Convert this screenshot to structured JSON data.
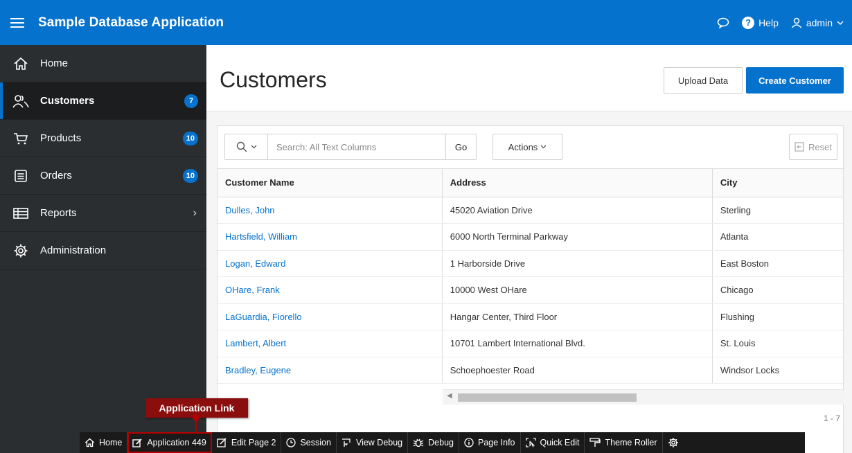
{
  "header": {
    "app_title": "Sample Database Application",
    "help_label": "Help",
    "user_label": "admin",
    "accent_color": "#0572ce"
  },
  "sidebar": {
    "items": [
      {
        "label": "Home",
        "icon": "home-icon"
      },
      {
        "label": "Customers",
        "icon": "users-icon",
        "badge": "7",
        "active": true
      },
      {
        "label": "Products",
        "icon": "cart-icon",
        "badge": "10"
      },
      {
        "label": "Orders",
        "icon": "list-icon",
        "badge": "10"
      },
      {
        "label": "Reports",
        "icon": "table-icon",
        "has_submenu": true
      },
      {
        "label": "Administration",
        "icon": "gear-icon"
      }
    ]
  },
  "page": {
    "title": "Customers",
    "upload_label": "Upload Data",
    "create_label": "Create Customer"
  },
  "report": {
    "search_placeholder": "Search: All Text Columns",
    "go_label": "Go",
    "actions_label": "Actions",
    "reset_label": "Reset",
    "columns": [
      "Customer Name",
      "Address",
      "City"
    ],
    "rows": [
      [
        "Dulles, John",
        "45020 Aviation Drive",
        "Sterling"
      ],
      [
        "Hartsfield, William",
        "6000 North Terminal Parkway",
        "Atlanta"
      ],
      [
        "Logan, Edward",
        "1 Harborside Drive",
        "East Boston"
      ],
      [
        "OHare, Frank",
        "10000 West OHare",
        "Chicago"
      ],
      [
        "LaGuardia, Fiorello",
        "Hangar Center, Third Floor",
        "Flushing"
      ],
      [
        "Lambert, Albert",
        "10701 Lambert International Blvd.",
        "St. Louis"
      ],
      [
        "Bradley, Eugene",
        "Schoephoester Road",
        "Windsor Locks"
      ]
    ],
    "pagination": "1 - 7"
  },
  "devbar": {
    "items": [
      {
        "label": "Home",
        "icon": "home-icon"
      },
      {
        "label": "Application 449",
        "icon": "edit-app-icon"
      },
      {
        "label": "Edit Page 2",
        "icon": "edit-page-icon"
      },
      {
        "label": "Session",
        "icon": "clock-icon"
      },
      {
        "label": "View Debug",
        "icon": "view-debug-icon"
      },
      {
        "label": "Debug",
        "icon": "bug-icon"
      },
      {
        "label": "Page Info",
        "icon": "info-icon"
      },
      {
        "label": "Quick Edit",
        "icon": "quick-edit-icon"
      },
      {
        "label": "Theme Roller",
        "icon": "theme-roller-icon"
      },
      {
        "label": "",
        "icon": "gear-icon"
      }
    ]
  },
  "callout": {
    "label": "Application Link",
    "color": "#8a0e0e"
  }
}
